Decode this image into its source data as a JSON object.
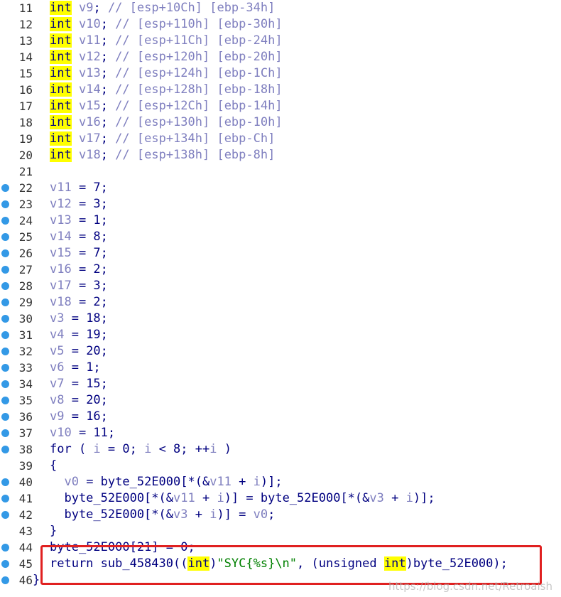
{
  "colors": {
    "keyword_highlight": "#ffff00",
    "breakpoint_dot": "#3399e6",
    "highlight_box": "#e02020",
    "text": "#000080",
    "comment": "#7f7fbf"
  },
  "lines": [
    {
      "num": "11",
      "dot": false,
      "code": "int v9; // [esp+10Ch] [ebp-34h]"
    },
    {
      "num": "12",
      "dot": false,
      "code": "int v10; // [esp+110h] [ebp-30h]"
    },
    {
      "num": "13",
      "dot": false,
      "code": "int v11; // [esp+11Ch] [ebp-24h]"
    },
    {
      "num": "14",
      "dot": false,
      "code": "int v12; // [esp+120h] [ebp-20h]"
    },
    {
      "num": "15",
      "dot": false,
      "code": "int v13; // [esp+124h] [ebp-1Ch]"
    },
    {
      "num": "16",
      "dot": false,
      "code": "int v14; // [esp+128h] [ebp-18h]"
    },
    {
      "num": "17",
      "dot": false,
      "code": "int v15; // [esp+12Ch] [ebp-14h]"
    },
    {
      "num": "18",
      "dot": false,
      "code": "int v16; // [esp+130h] [ebp-10h]"
    },
    {
      "num": "19",
      "dot": false,
      "code": "int v17; // [esp+134h] [ebp-Ch]"
    },
    {
      "num": "20",
      "dot": false,
      "code": "int v18; // [esp+138h] [ebp-8h]"
    },
    {
      "num": "21",
      "dot": false,
      "code": ""
    },
    {
      "num": "22",
      "dot": true,
      "code": "v11 = 7;"
    },
    {
      "num": "23",
      "dot": true,
      "code": "v12 = 3;"
    },
    {
      "num": "24",
      "dot": true,
      "code": "v13 = 1;"
    },
    {
      "num": "25",
      "dot": true,
      "code": "v14 = 8;"
    },
    {
      "num": "26",
      "dot": true,
      "code": "v15 = 7;"
    },
    {
      "num": "27",
      "dot": true,
      "code": "v16 = 2;"
    },
    {
      "num": "28",
      "dot": true,
      "code": "v17 = 3;"
    },
    {
      "num": "29",
      "dot": true,
      "code": "v18 = 2;"
    },
    {
      "num": "30",
      "dot": true,
      "code": "v3 = 18;"
    },
    {
      "num": "31",
      "dot": true,
      "code": "v4 = 19;"
    },
    {
      "num": "32",
      "dot": true,
      "code": "v5 = 20;"
    },
    {
      "num": "33",
      "dot": true,
      "code": "v6 = 1;"
    },
    {
      "num": "34",
      "dot": true,
      "code": "v7 = 15;"
    },
    {
      "num": "35",
      "dot": true,
      "code": "v8 = 20;"
    },
    {
      "num": "36",
      "dot": true,
      "code": "v9 = 16;"
    },
    {
      "num": "37",
      "dot": true,
      "code": "v10 = 11;"
    },
    {
      "num": "38",
      "dot": true,
      "code": "for ( i = 0; i < 8; ++i )"
    },
    {
      "num": "39",
      "dot": false,
      "code": "{"
    },
    {
      "num": "40",
      "dot": true,
      "code": "  v0 = byte_52E000[*(&v11 + i)];"
    },
    {
      "num": "41",
      "dot": true,
      "code": "  byte_52E000[*(&v11 + i)] = byte_52E000[*(&v3 + i)];"
    },
    {
      "num": "42",
      "dot": true,
      "code": "  byte_52E000[*(&v3 + i)] = v0;"
    },
    {
      "num": "43",
      "dot": false,
      "code": "}"
    },
    {
      "num": "44",
      "dot": true,
      "code": "byte_52E000[21] = 0;"
    },
    {
      "num": "45",
      "dot": true,
      "code": "return sub_458430((int)\"SYC{%s}\\n\", (unsigned int)byte_52E000);"
    },
    {
      "num": "46",
      "dot": true,
      "code": "}"
    }
  ],
  "watermark": "https://blog.csdn.net/Retroaish"
}
